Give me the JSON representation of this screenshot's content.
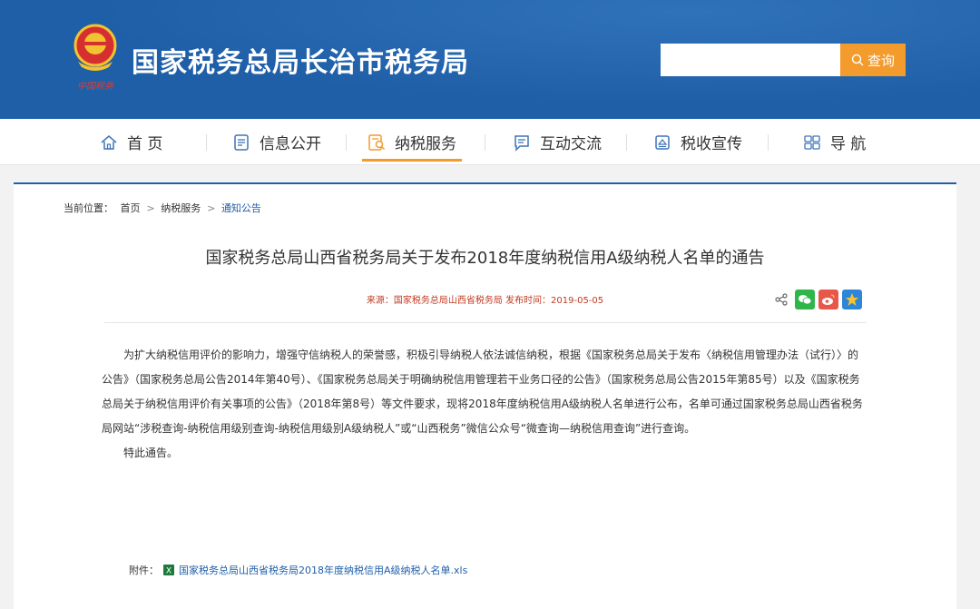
{
  "header": {
    "site_title": "国家税务总局长治市税务局",
    "emblem_caption": "中国税务",
    "search_placeholder": "",
    "search_button": "查询"
  },
  "nav": {
    "items": [
      {
        "label": "首 页",
        "icon": "home-icon"
      },
      {
        "label": "信息公开",
        "icon": "document-icon"
      },
      {
        "label": "纳税服务",
        "icon": "search-document-icon"
      },
      {
        "label": "互动交流",
        "icon": "chat-icon"
      },
      {
        "label": "税收宣传",
        "icon": "broadcast-icon"
      },
      {
        "label": "导 航",
        "icon": "grid-icon"
      }
    ],
    "active_index": 2
  },
  "breadcrumb": {
    "prefix": "当前位置：",
    "items": [
      "首页",
      "纳税服务",
      "通知公告"
    ]
  },
  "article": {
    "title": "国家税务总局山西省税务局关于发布2018年度纳税信用A级纳税人名单的通告",
    "meta": "来源：国家税务总局山西省税务局 发布时间：2019-05-05",
    "paragraph": "为扩大纳税信用评价的影响力，增强守信纳税人的荣誉感，积极引导纳税人依法诚信纳税，根据《国家税务总局关于发布〈纳税信用管理办法（试行）〉的公告》（国家税务总局公告2014年第40号）、《国家税务总局关于明确纳税信用管理若干业务口径的公告》（国家税务总局公告2015年第85号）以及《国家税务总局关于纳税信用评价有关事项的公告》（2018年第8号）等文件要求，现将2018年度纳税信用A级纳税人名单进行公布，名单可通过国家税务总局山西省税务局网站“涉税查询-纳税信用级别查询-纳税信用级别A级纳税人”或“山西税务”微信公众号“微查询—纳税信用查询”进行查询。",
    "closing": "特此通告。",
    "attachment_label": "附件：",
    "attachment_name": "国家税务总局山西省税务局2018年度纳税信用A级纳税人名单.xls"
  },
  "share_icons": [
    "share-icon",
    "wechat-icon",
    "weibo-icon",
    "favorite-icon"
  ],
  "colors": {
    "header_blue": "#1f5fa8",
    "accent_orange": "#f39b2c",
    "meta_red": "#c23b22"
  }
}
